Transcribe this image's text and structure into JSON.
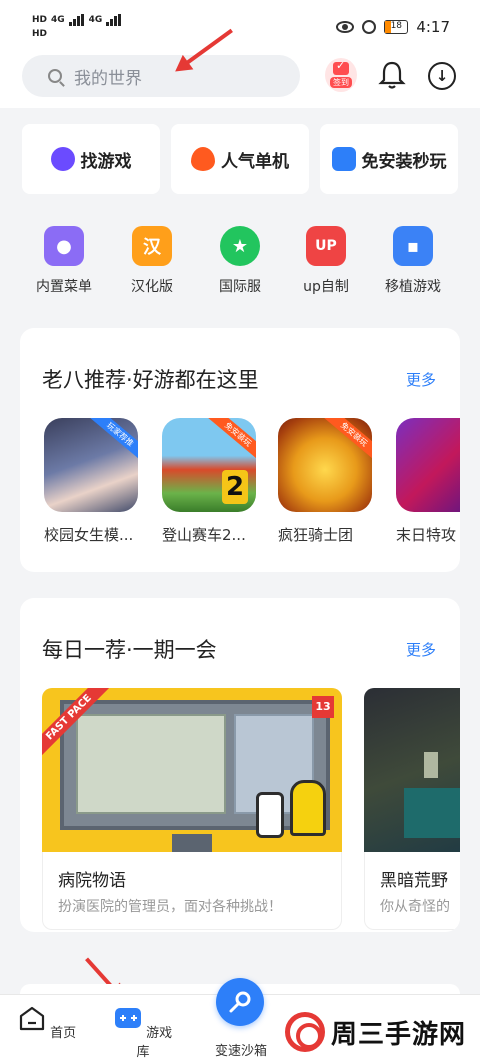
{
  "status_bar": {
    "sim1": "HD",
    "sim2": "HD",
    "net1": "4G",
    "net2": "4G",
    "battery": "18",
    "time": "4:17"
  },
  "header": {
    "search_placeholder": "我的世界",
    "checkin_label": "签到"
  },
  "quick_tiles": [
    {
      "label": "找游戏",
      "icon": "gamepad-icon",
      "color": "#6b4bff"
    },
    {
      "label": "人气单机",
      "icon": "flame-icon",
      "color": "#ff5a1f"
    },
    {
      "label": "免安装秒玩",
      "icon": "controller-icon",
      "color": "#2d7ff9"
    }
  ],
  "categories": [
    {
      "label": "内置菜单",
      "icon": "menu-book-icon",
      "color": "#8b6cf5"
    },
    {
      "label": "汉化版",
      "icon": "han-icon",
      "glyph": "汉",
      "color": "#ff9f1a"
    },
    {
      "label": "国际服",
      "icon": "globe-icon",
      "color": "#22c55e"
    },
    {
      "label": "up自制",
      "icon": "up-icon",
      "glyph": "UP",
      "color": "#ef4444"
    },
    {
      "label": "移植游戏",
      "icon": "monitor-icon",
      "color": "#3b82f6"
    }
  ],
  "recommend": {
    "title": "老八推荐·好游都在这里",
    "more": "更多",
    "games": [
      {
        "name": "校园女生模...",
        "tag": "玩家荐推",
        "tag_color": "#2d7ff9"
      },
      {
        "name": "登山赛车2...",
        "tag": "免安装玩",
        "tag_color": "#ff5a1f"
      },
      {
        "name": "疯狂骑士团",
        "tag": "免安装玩",
        "tag_color": "#ff5a1f"
      },
      {
        "name": "末日特攻",
        "tag": "",
        "tag_color": "#ff5a1f"
      }
    ]
  },
  "daily": {
    "title": "每日一荐·一期一会",
    "more": "更多",
    "items": [
      {
        "name": "病院物语",
        "desc": "扮演医院的管理员，面对各种挑战！",
        "badge": "FAST PACE",
        "num": "13"
      },
      {
        "name": "黑暗荒野",
        "desc": "你从奇怪的"
      }
    ]
  },
  "nav": {
    "home": "首页",
    "library": "游戏库",
    "sandbox": "变速沙箱"
  },
  "watermark": "周三手游网"
}
